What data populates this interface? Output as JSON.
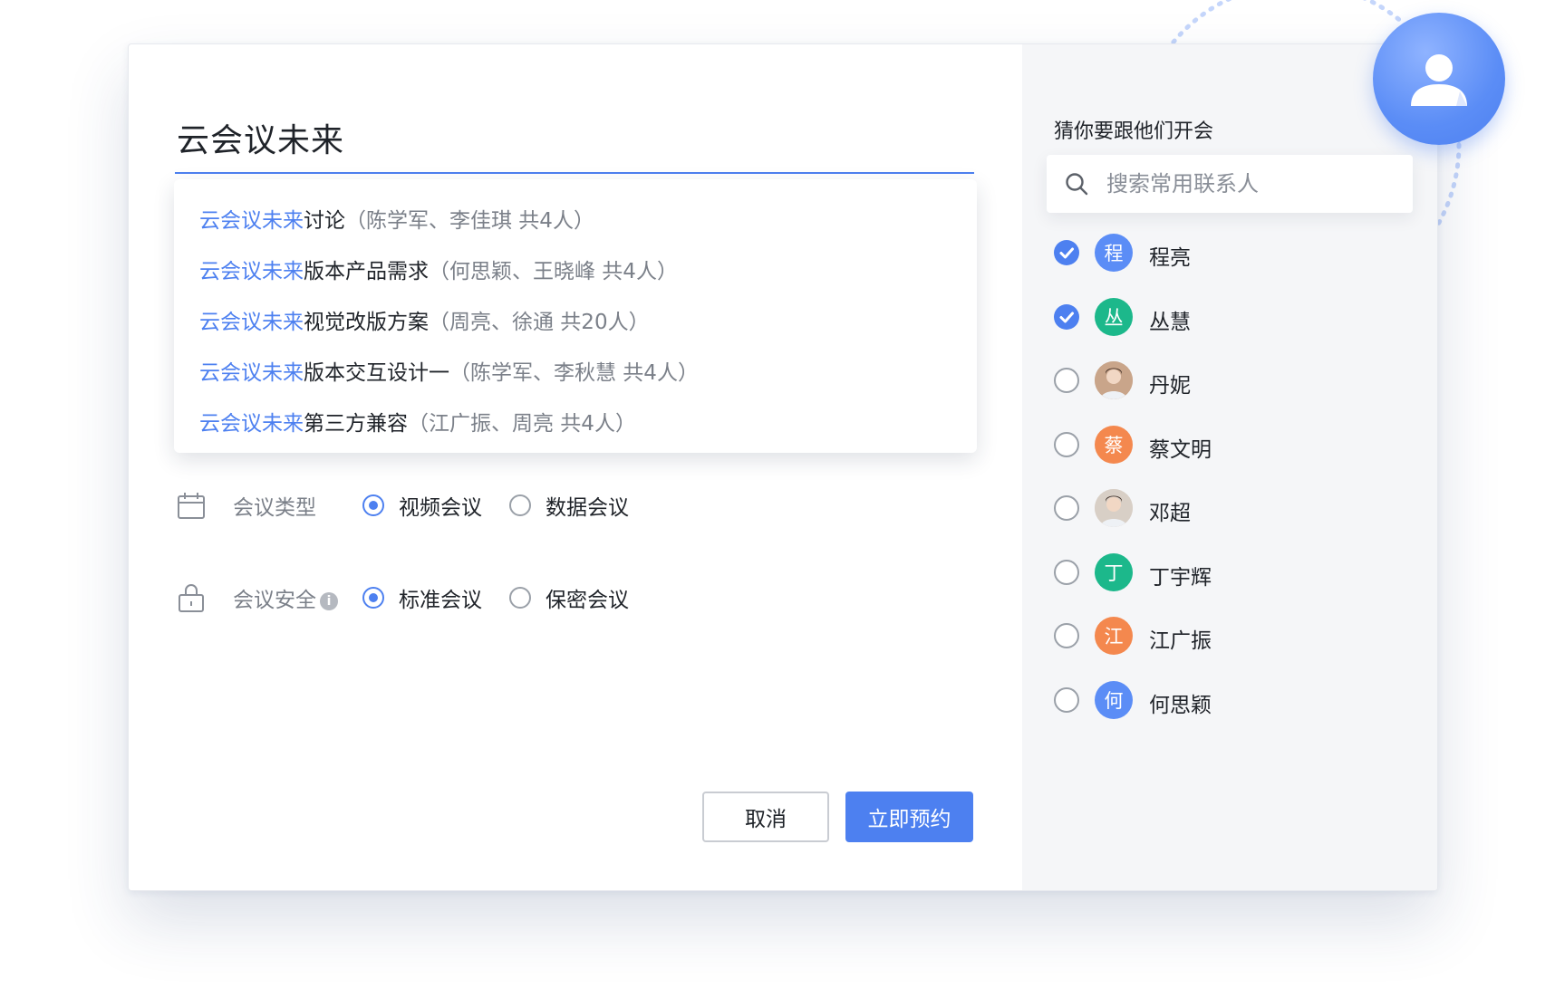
{
  "meeting": {
    "title": "云会议未来"
  },
  "suggestions": [
    {
      "highlight": "云会议未来",
      "rest": "讨论",
      "meta": "（陈学军、李佳琪 共4人）"
    },
    {
      "highlight": "云会议未来",
      "rest": "版本产品需求",
      "meta": "（何思颖、王晓峰 共4人）"
    },
    {
      "highlight": "云会议未来",
      "rest": "视觉改版方案",
      "meta": "（周亮、徐通 共20人）"
    },
    {
      "highlight": "云会议未来",
      "rest": "版本交互设计一",
      "meta": "（陈学军、李秋慧 共4人）"
    },
    {
      "highlight": "云会议未来",
      "rest": "第三方兼容",
      "meta": "（江广振、周亮 共4人）"
    }
  ],
  "meeting_type": {
    "label": "会议类型",
    "options": [
      "视频会议",
      "数据会议"
    ],
    "selected": "视频会议"
  },
  "meeting_security": {
    "label": "会议安全",
    "info_icon": "i",
    "options": [
      "标准会议",
      "保密会议"
    ],
    "selected": "标准会议"
  },
  "actions": {
    "cancel_label": "取消",
    "book_label": "立即预约"
  },
  "contacts_panel": {
    "title": "猜你要跟他们开会",
    "search_placeholder": "搜索常用联系人",
    "contacts": [
      {
        "name": "程亮",
        "initial": "程",
        "checked": true,
        "color": "#5b8df6",
        "photo": false
      },
      {
        "name": "丛慧",
        "initial": "丛",
        "checked": true,
        "color": "#1cb88b",
        "photo": false
      },
      {
        "name": "丹妮",
        "initial": "",
        "checked": false,
        "color": "#c9a58a",
        "photo": true
      },
      {
        "name": "蔡文明",
        "initial": "蔡",
        "checked": false,
        "color": "#f4884e",
        "photo": false
      },
      {
        "name": "邓超",
        "initial": "",
        "checked": false,
        "color": "#d8cfc6",
        "photo": true
      },
      {
        "name": "丁宇辉",
        "initial": "丁",
        "checked": false,
        "color": "#1cb88b",
        "photo": false
      },
      {
        "name": "江广振",
        "initial": "江",
        "checked": false,
        "color": "#f4884e",
        "photo": false
      },
      {
        "name": "何思颖",
        "initial": "何",
        "checked": false,
        "color": "#5b8df6",
        "photo": false
      }
    ]
  },
  "colors": {
    "accent": "#4d80f0",
    "panel_bg": "#f5f6f8",
    "green": "#1cb88b",
    "orange": "#f4884e"
  }
}
